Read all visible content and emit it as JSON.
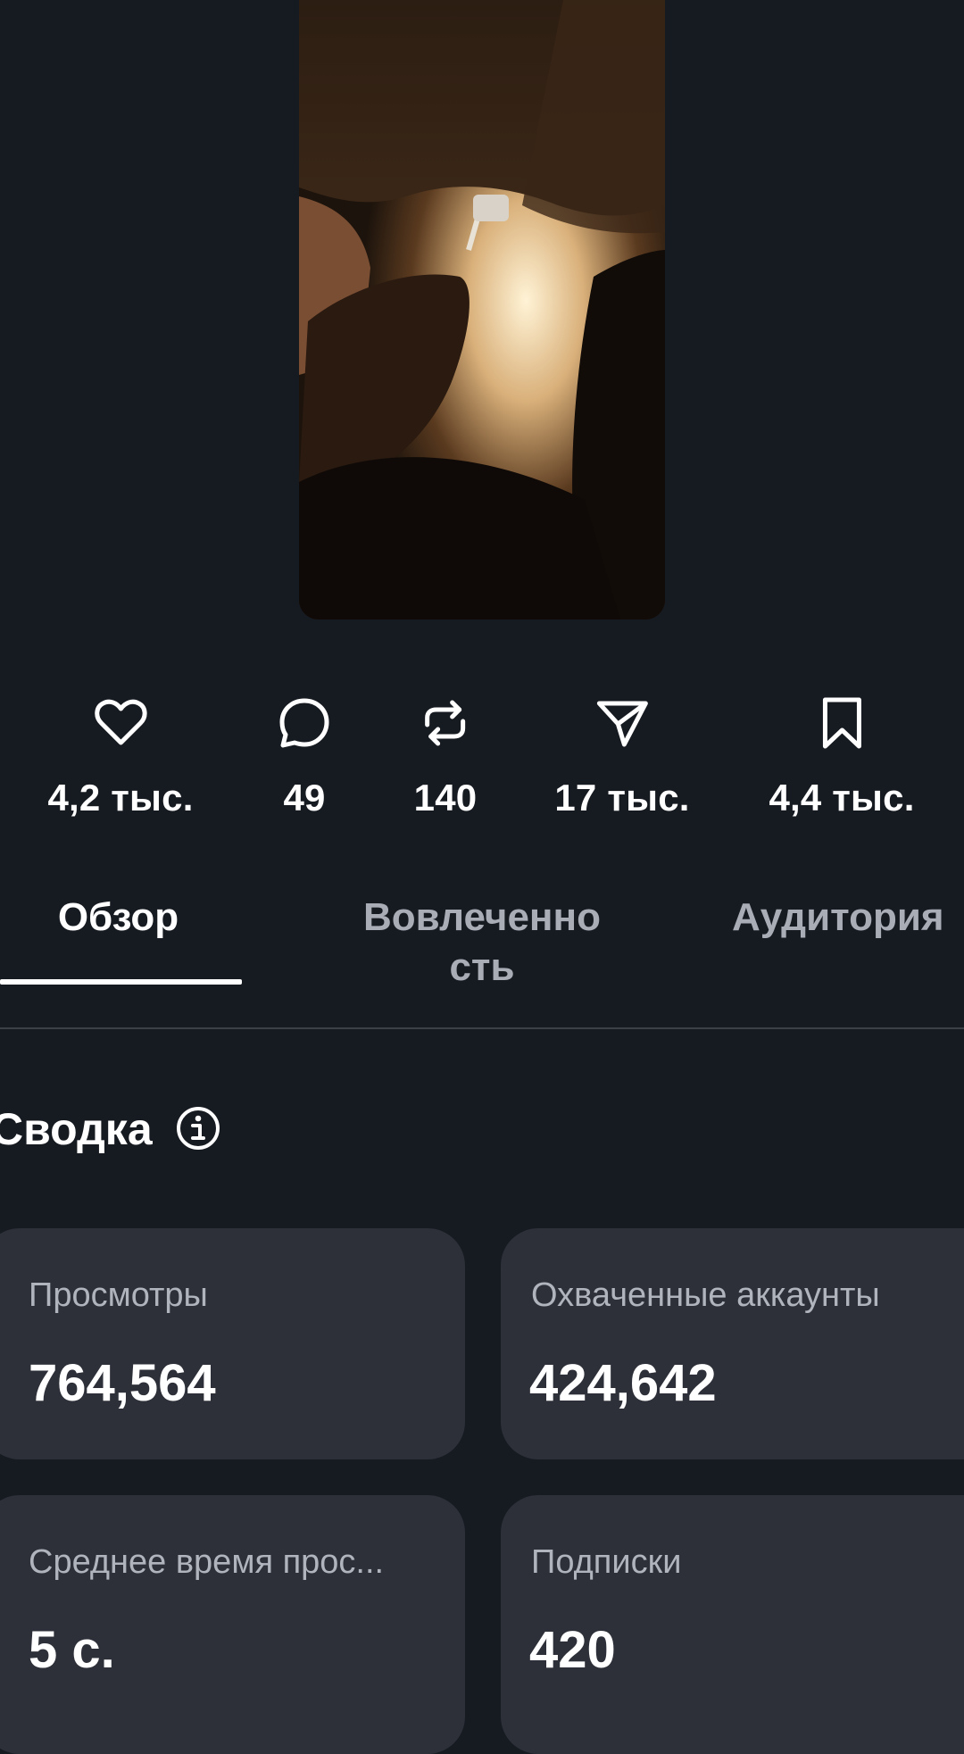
{
  "stats": {
    "likes": "4,2 тыс.",
    "comments": "49",
    "reposts": "140",
    "shares": "17 тыс.",
    "saves": "4,4 тыс."
  },
  "tabs": {
    "overview": "Обзор",
    "engagement_line1": "Вовлеченно",
    "engagement_line2": "сть",
    "audience": "Аудитория"
  },
  "summary": {
    "title": "Сводка",
    "cards": [
      {
        "label": "Просмотры",
        "value": "764,564"
      },
      {
        "label": "Охваченные аккаунты",
        "value": "424,642"
      },
      {
        "label": "Среднее время прос...",
        "value": "5 с."
      },
      {
        "label": "Подписки",
        "value": "420"
      }
    ]
  },
  "icons": {
    "likes": "heart-icon",
    "comments": "comment-bubble-icon",
    "reposts": "repost-icon",
    "shares": "send-icon",
    "saves": "bookmark-icon",
    "summary_info": "info-icon"
  },
  "colors": {
    "background": "#161a21",
    "card": "#2d3039",
    "text": "#ffffff",
    "muted_text": "#b0b4bd"
  }
}
